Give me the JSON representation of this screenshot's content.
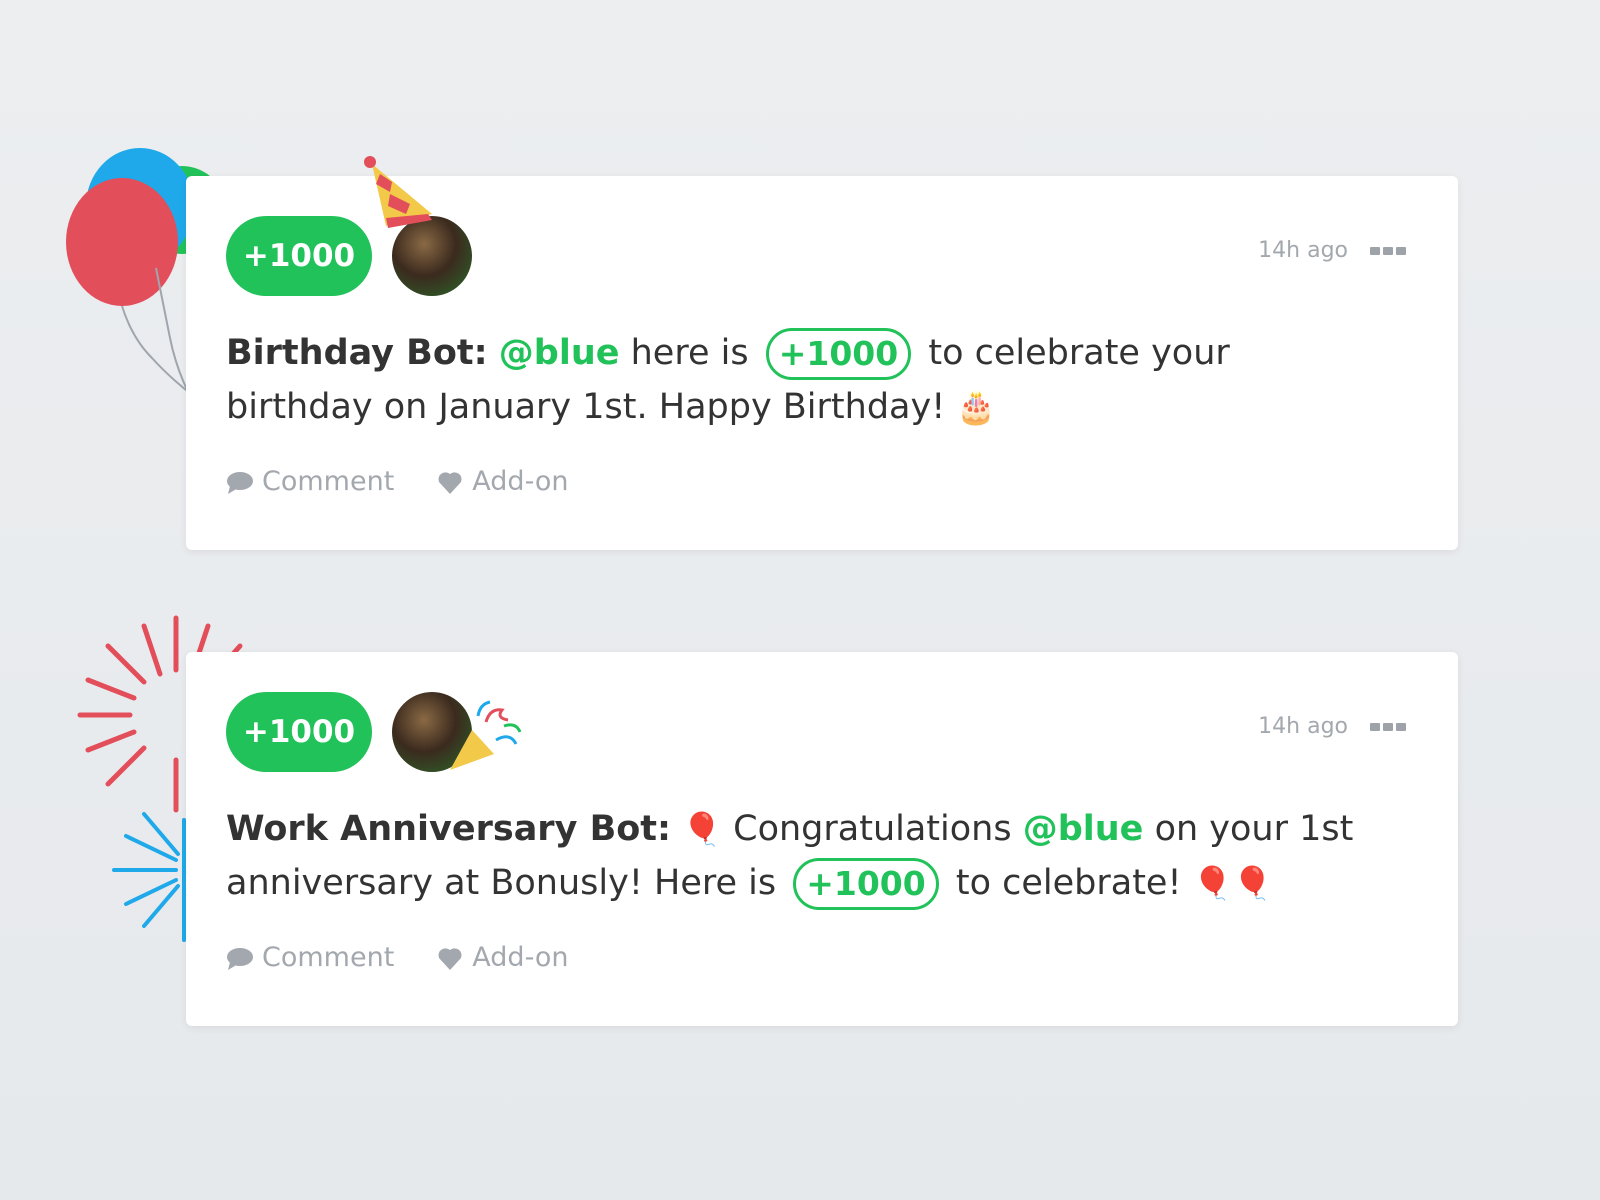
{
  "colors": {
    "accent": "#22c25a",
    "muted": "#a3a8ae",
    "text": "#333333"
  },
  "posts": [
    {
      "amount": "+1000",
      "time": "14h ago",
      "bot": "Birthday Bot:",
      "mention": "@blue",
      "text_a": " here is ",
      "pill": "+1000",
      "text_b": " to celebrate your birthday on January 1st. Happy Birthday! ",
      "emoji": "🎂",
      "comment_label": "Comment",
      "addon_label": "Add-on"
    },
    {
      "amount": "+1000",
      "time": "14h ago",
      "bot": "Work Anniversary Bot:",
      "emoji_lead": "🎈",
      "text_0": " Congratulations ",
      "mention": "@blue",
      "text_a": " on your 1st anniversary at Bonusly! Here is ",
      "pill": "+1000",
      "text_b": " to celebrate! ",
      "emoji": "🎈🎈",
      "comment_label": "Comment",
      "addon_label": "Add-on"
    }
  ]
}
